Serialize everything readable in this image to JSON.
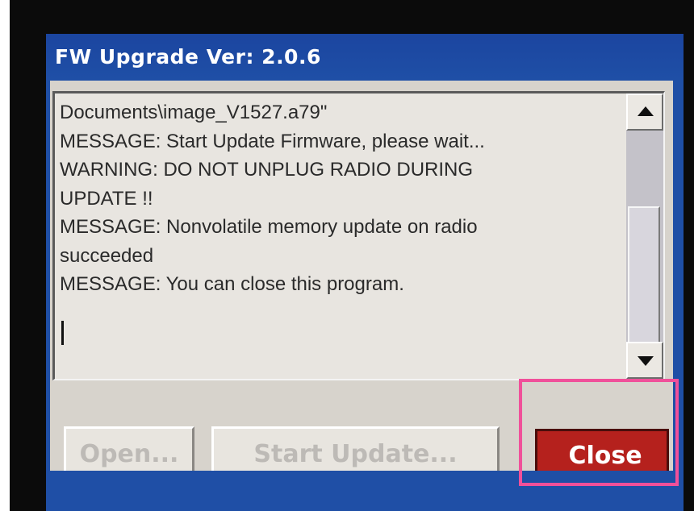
{
  "window": {
    "title": "FW Upgrade Ver: 2.0.6"
  },
  "log": {
    "lines": [
      "Documents\\image_V1527.a79\"",
      "MESSAGE: Start Update Firmware, please wait...",
      "WARNING: DO NOT UNPLUG RADIO DURING",
      "UPDATE !!",
      "MESSAGE: Nonvolatile memory update on radio",
      "succeeded",
      "MESSAGE: You can close this program."
    ]
  },
  "buttons": {
    "open_label": "Open...",
    "start_update_label": "Start Update...",
    "close_label": "Close"
  },
  "colors": {
    "title_bar": "#1f4fa6",
    "close_button": "#b5211d",
    "highlight_box": "#f0509a"
  },
  "icons": {
    "scroll_up": "triangle-up",
    "scroll_down": "triangle-down"
  }
}
